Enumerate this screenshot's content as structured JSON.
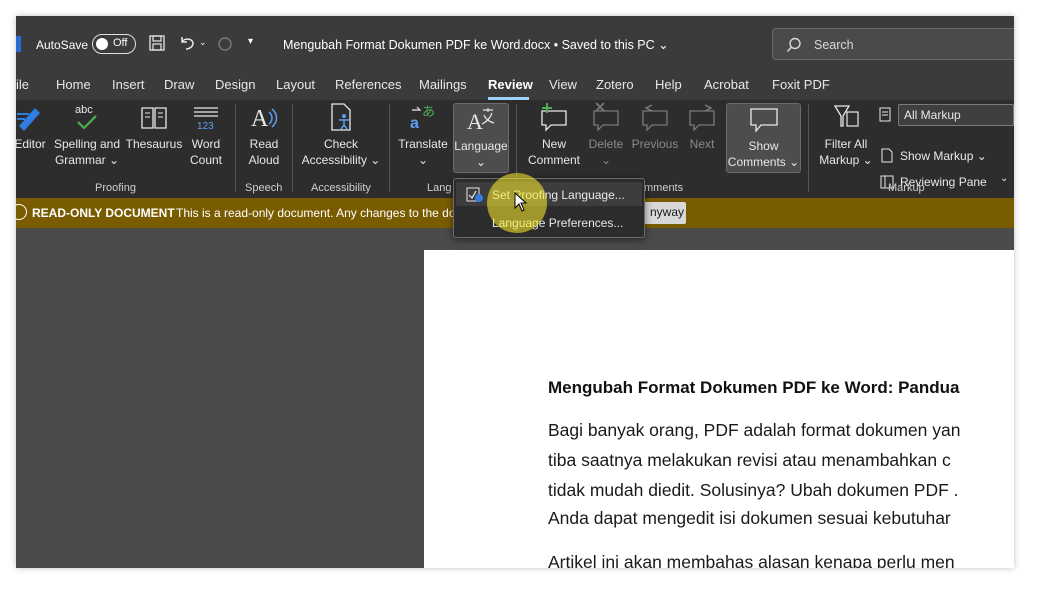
{
  "titlebar": {
    "autosave_label": "AutoSave",
    "autosave_state": "Off",
    "document_title": "Mengubah Format Dokumen PDF ke Word.docx  •  Saved to this PC ⌄",
    "search_placeholder": "Search"
  },
  "tabs": [
    "ile",
    "Home",
    "Insert",
    "Draw",
    "Design",
    "Layout",
    "References",
    "Mailings",
    "Review",
    "View",
    "Zotero",
    "Help",
    "Acrobat",
    "Foxit PDF"
  ],
  "active_tab": "Review",
  "ribbon": {
    "editor": "Editor",
    "spelling": [
      "Spelling and",
      "Grammar ⌄"
    ],
    "thesaurus": "Thesaurus",
    "word_count": [
      "Word",
      "Count"
    ],
    "read_aloud": [
      "Read",
      "Aloud"
    ],
    "check_accessibility": [
      "Check",
      "Accessibility ⌄"
    ],
    "translate": [
      "Translate",
      "⌄"
    ],
    "language": [
      "Language",
      "⌄"
    ],
    "new_comment": [
      "New",
      "Comment"
    ],
    "delete": [
      "Delete",
      "⌄"
    ],
    "previous": "Previous",
    "next": "Next",
    "show_comments": [
      "Show",
      "Comments ⌄"
    ],
    "filter_all_markup": [
      "Filter All",
      "Markup ⌄"
    ],
    "all_markup": "All Markup",
    "show_markup": "Show Markup ⌄",
    "reviewing_pane": "Reviewing Pane",
    "groups": {
      "proofing": "Proofing",
      "speech": "Speech",
      "accessibility": "Accessibility",
      "language": "Lang",
      "comments": "mments",
      "markup": "Markup"
    }
  },
  "notification": {
    "title": "READ-ONLY DOCUMENT",
    "message": "This is a read-only document. Any changes to the do",
    "button": "nyway"
  },
  "language_menu": {
    "items": [
      "Set Proofing Language...",
      "Language Preferences..."
    ]
  },
  "document": {
    "heading": "Mengubah Format Dokumen PDF ke Word: Pandua",
    "paragraph_1": [
      "Bagi banyak orang, PDF adalah format dokumen yan",
      "tiba saatnya melakukan revisi atau menambahkan c",
      "tidak mudah diedit. Solusinya? Ubah dokumen PDF .",
      "Anda dapat mengedit isi dokumen sesuai kebutuhar"
    ],
    "paragraph_2_start": "Artikel ini akan membahas alasan kenapa perlu men"
  },
  "colors": {
    "titlebar_bg": "#3b3b3b",
    "ribbon_bg": "#2d2d2d",
    "notification_bg": "#7a5c00",
    "active_tab_underline": "#9fd2ff",
    "cursor_highlight": "#fff028"
  }
}
